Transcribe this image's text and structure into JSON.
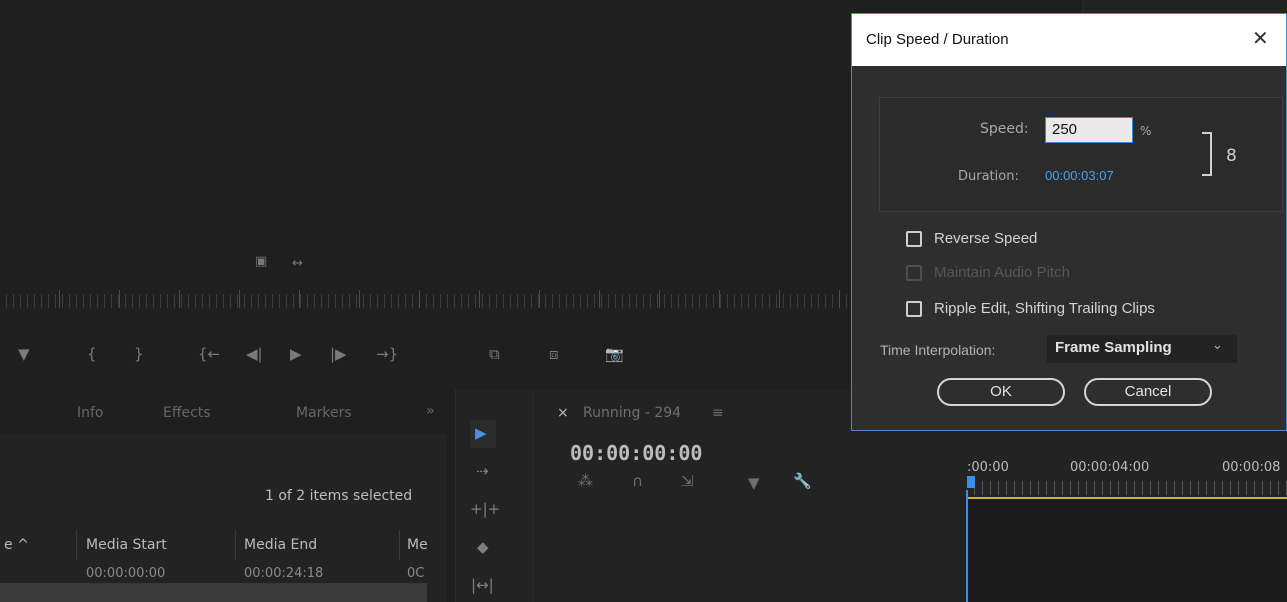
{
  "monitor": {
    "mini_controls": [
      "▣",
      "↔"
    ],
    "transport": [
      "▼",
      "{",
      "}",
      "{←",
      "◀|",
      "▶",
      "|▶",
      "→}",
      "⧉",
      "⧈",
      "📷"
    ]
  },
  "project_panel": {
    "tabs": [
      "Info",
      "Effects",
      "Markers",
      "»"
    ],
    "items_selected": "1 of 2 items selected",
    "columns": [
      "e ^",
      "Media Start",
      "Media End",
      "Me"
    ],
    "row": [
      "00:00:00:00",
      "00:00:24:18",
      "0C"
    ]
  },
  "tools": [
    "▶",
    "⇢",
    "+|+",
    "◆",
    "|↔|"
  ],
  "timeline": {
    "tab_close": "×",
    "sequence_name": "Running - 294",
    "menu_icon": "≡",
    "timecode": "00:00:00:00",
    "ruler_times": [
      ":00:00",
      "00:00:04:00",
      "00:00:08"
    ]
  },
  "dialog": {
    "title": "Clip Speed / Duration",
    "close": "✕",
    "speed_label": "Speed:",
    "speed_value": "250",
    "percent": "%",
    "duration_label": "Duration:",
    "duration_value": "00:00:03:07",
    "link_icon": "8",
    "checkboxes": [
      {
        "label": "Reverse Speed",
        "checked": false,
        "disabled": false
      },
      {
        "label": "Maintain Audio Pitch",
        "checked": false,
        "disabled": true
      },
      {
        "label": "Ripple Edit, Shifting Trailing Clips",
        "checked": false,
        "disabled": false
      }
    ],
    "interpolation_label": "Time Interpolation:",
    "interpolation_value": "Frame Sampling",
    "interpolation_chevron": "⌄",
    "ok_label": "OK",
    "cancel_label": "Cancel"
  }
}
